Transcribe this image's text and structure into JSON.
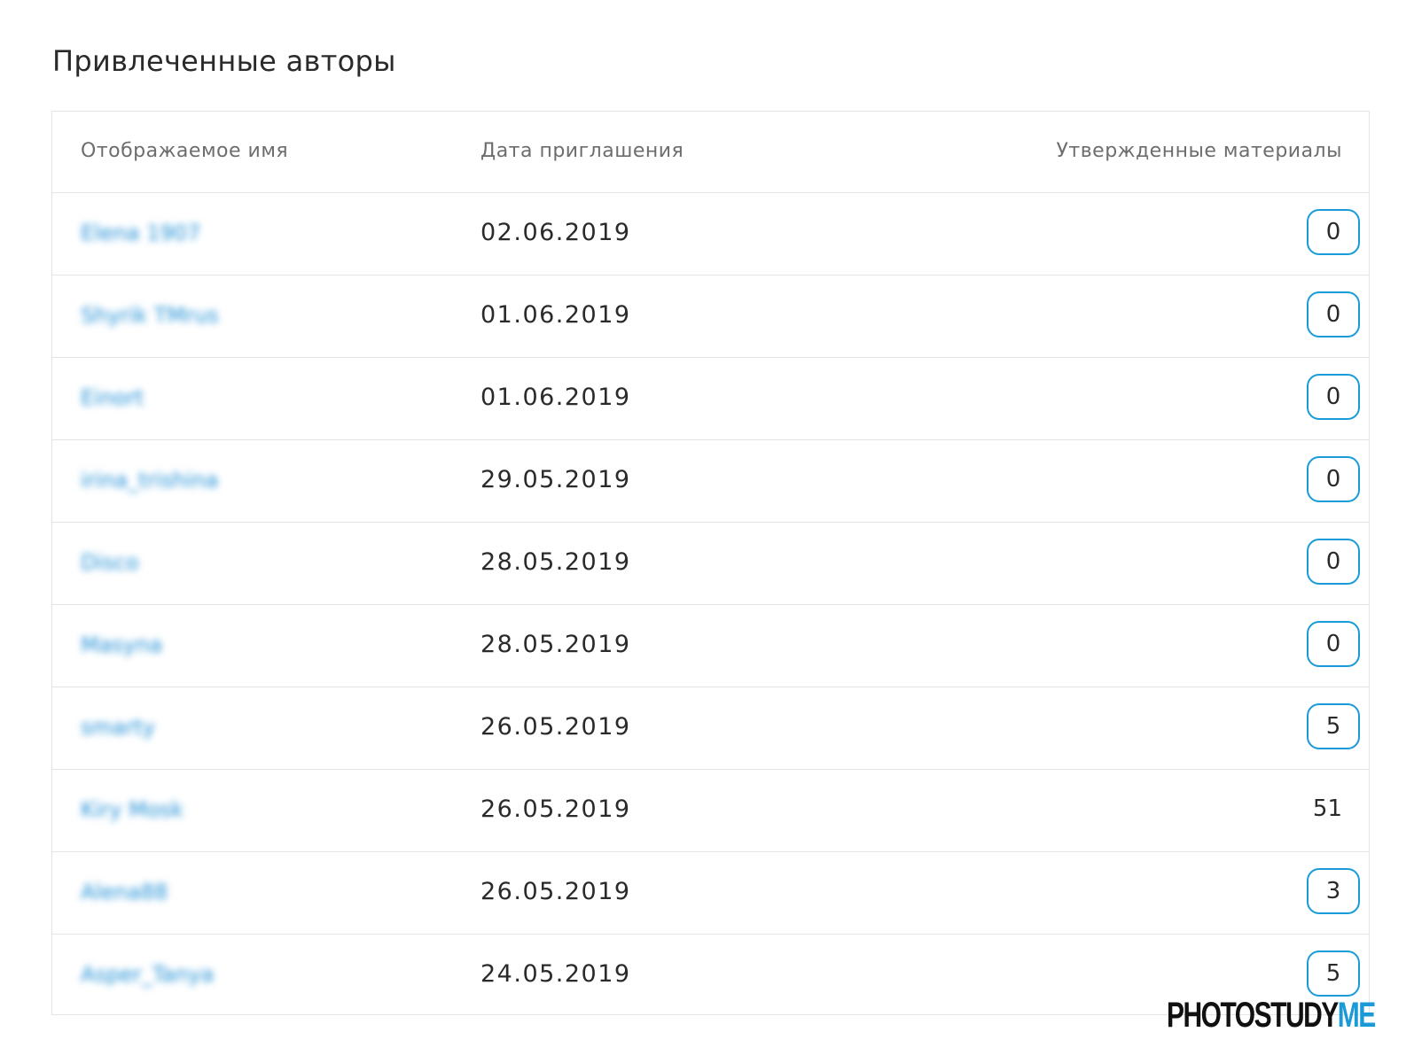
{
  "page": {
    "title": "Привлеченные авторы"
  },
  "table": {
    "columns": {
      "name": "Отображаемое имя",
      "date": "Дата приглашения",
      "approved": "Утвержденные материалы"
    },
    "rows": [
      {
        "name": "Elena 1907",
        "date": "02.06.2019",
        "approved": "0",
        "badge": true
      },
      {
        "name": "Shyrik TMrus",
        "date": "01.06.2019",
        "approved": "0",
        "badge": true
      },
      {
        "name": "Einort",
        "date": "01.06.2019",
        "approved": "0",
        "badge": true
      },
      {
        "name": "irina_trishina",
        "date": "29.05.2019",
        "approved": "0",
        "badge": true
      },
      {
        "name": "Disco",
        "date": "28.05.2019",
        "approved": "0",
        "badge": true
      },
      {
        "name": "Masyna",
        "date": "28.05.2019",
        "approved": "0",
        "badge": true
      },
      {
        "name": "smarty",
        "date": "26.05.2019",
        "approved": "5",
        "badge": true
      },
      {
        "name": "Kiry Mosk",
        "date": "26.05.2019",
        "approved": "51",
        "badge": false
      },
      {
        "name": "Alena88",
        "date": "26.05.2019",
        "approved": "3",
        "badge": true
      },
      {
        "name": "Asper_Tanya",
        "date": "24.05.2019",
        "approved": "5",
        "badge": true
      }
    ]
  },
  "watermark": {
    "part1": "PHOTOSTUDY",
    "part2": "ME"
  },
  "colors": {
    "accent": "#1a9bd8",
    "text": "#2a2a2a",
    "header_text": "#6d6d6d",
    "border": "#e3e3e3"
  }
}
